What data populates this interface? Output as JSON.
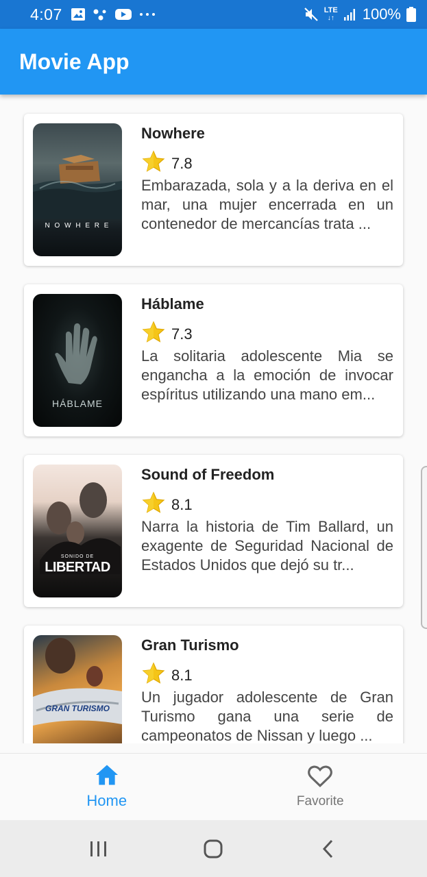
{
  "status_bar": {
    "time": "4:07",
    "battery": "100%",
    "network": "LTE",
    "icons_left": [
      "gallery-icon",
      "dots-icon",
      "youtube-icon",
      "more-icon"
    ],
    "icons_right": [
      "mute-icon",
      "lte-icon",
      "signal-icon",
      "battery-icon"
    ]
  },
  "app_bar": {
    "title": "Movie App"
  },
  "movies": [
    {
      "title": "Nowhere",
      "rating": "7.8",
      "description": "Embarazada, sola y a la deriva en el mar, una mujer encerrada en un contenedor de mercancías trata ...",
      "poster_text": "N O W H E R E"
    },
    {
      "title": "Háblame",
      "rating": "7.3",
      "description": "La solitaria adolescente Mia se engancha a la emoción de invocar espíritus utilizando una mano em...",
      "poster_text": "HÁBLAME"
    },
    {
      "title": "Sound of Freedom",
      "rating": "8.1",
      "description": "Narra la historia de Tim Ballard, un exagente de Seguridad Nacional de Estados Unidos que dejó su tr...",
      "poster_text_small": "SONIDO DE",
      "poster_text": "LIBERTAD"
    },
    {
      "title": "Gran Turismo",
      "rating": "8.1",
      "description": "Un jugador adolescente de Gran Turismo gana una serie de campeonatos de Nissan y luego ...",
      "poster_text": "GRAN TURISMO"
    }
  ],
  "bottom_nav": {
    "items": [
      {
        "label": "Home",
        "icon": "home-icon",
        "active": true
      },
      {
        "label": "Favorite",
        "icon": "heart-icon",
        "active": false
      }
    ]
  },
  "colors": {
    "status_bar": "#1976d2",
    "app_bar": "#2196f3",
    "star": "#f5c518",
    "active_nav": "#2196f3"
  }
}
